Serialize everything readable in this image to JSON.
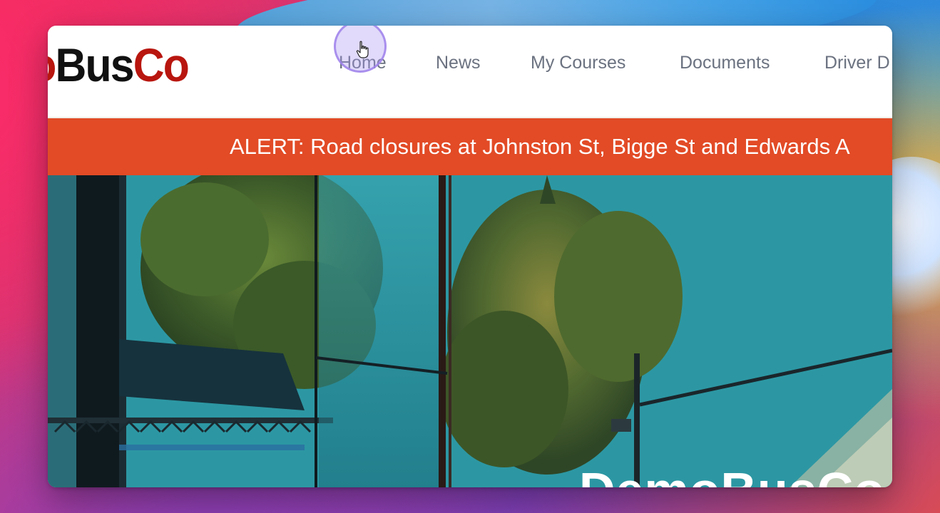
{
  "header": {
    "logo_part_a": "no",
    "logo_part_b": "Bus",
    "logo_part_c": "Co"
  },
  "nav": {
    "items": [
      "Home",
      "News",
      "My Courses",
      "Documents",
      "Driver D"
    ]
  },
  "alert": {
    "text": "ALERT: Road closures at Johnston St, Bigge St and Edwards A"
  },
  "hero": {
    "title": "DemoBusCo"
  },
  "cursor": {
    "icon": "pointing-hand-cursor-icon"
  },
  "colors": {
    "alert_background": "#e24b26",
    "logo_red": "#b8160f",
    "logo_black": "#111111",
    "nav_text": "#6b7280"
  }
}
